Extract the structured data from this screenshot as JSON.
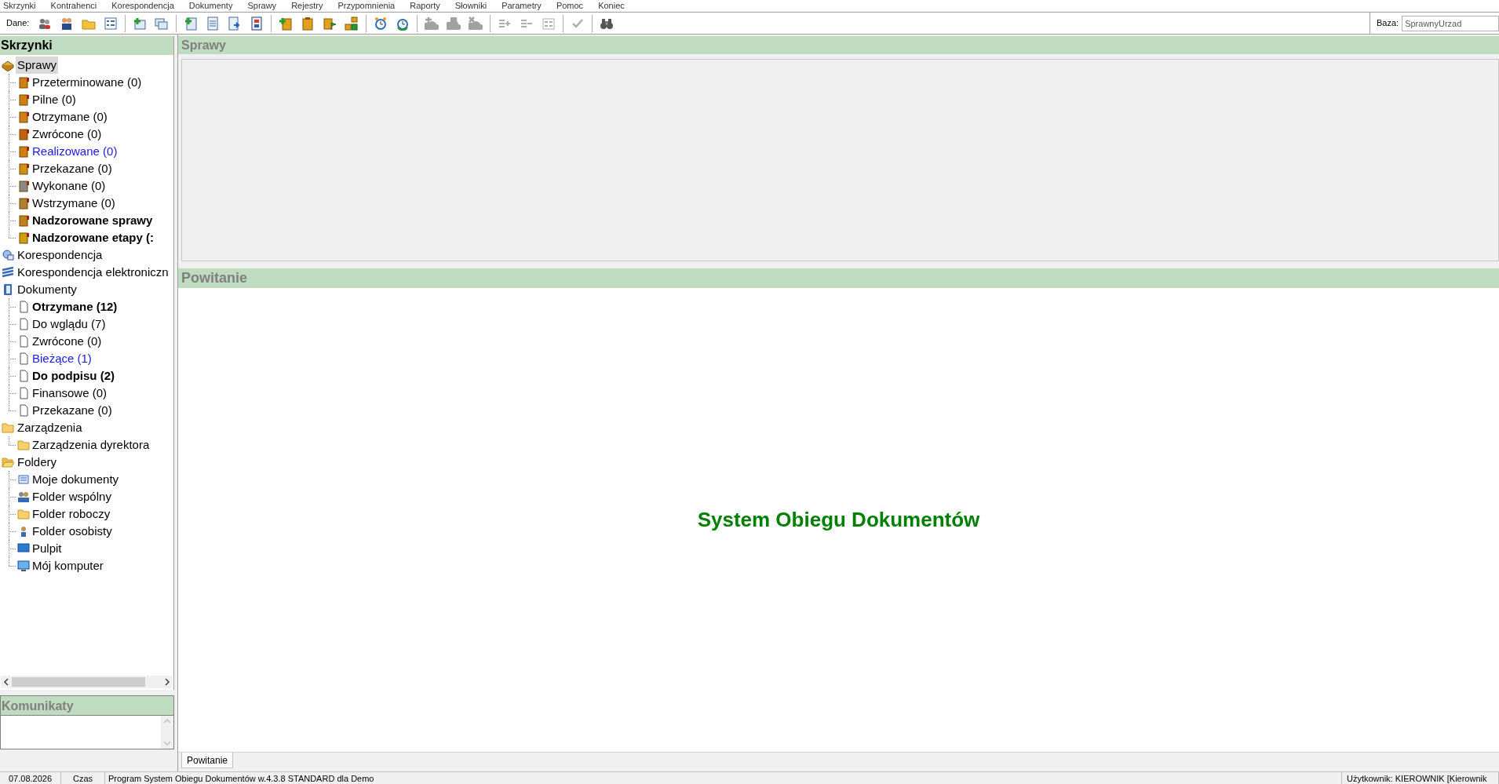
{
  "menu": [
    "Skrzynki",
    "Kontrahenci",
    "Korespondencja",
    "Dokumenty",
    "Sprawy",
    "Rejestry",
    "Przypomnienia",
    "Raporty",
    "Słowniki",
    "Parametry",
    "Pomoc",
    "Koniec"
  ],
  "toolbar": {
    "label": "Dane:",
    "groups": [
      [
        {
          "disabled": false
        },
        {
          "disabled": false
        },
        {
          "disabled": false
        },
        {
          "disabled": false
        }
      ],
      [
        {
          "disabled": false
        },
        {
          "disabled": false
        }
      ],
      [
        {
          "disabled": false
        },
        {
          "disabled": false
        },
        {
          "disabled": false
        },
        {
          "disabled": false
        }
      ],
      [
        {
          "disabled": false
        },
        {
          "disabled": false
        },
        {
          "disabled": false
        },
        {
          "disabled": false
        }
      ],
      [
        {
          "disabled": false
        },
        {
          "disabled": false
        }
      ],
      [
        {
          "disabled": true
        },
        {
          "disabled": true
        },
        {
          "disabled": true
        }
      ],
      [
        {
          "disabled": true
        },
        {
          "disabled": true
        },
        {
          "disabled": true
        }
      ],
      [
        {
          "disabled": true
        }
      ],
      [
        {
          "disabled": false
        }
      ]
    ],
    "database": {
      "label": "Baza:",
      "value": "SprawnyUrzad"
    }
  },
  "sidebar": {
    "title": "Skrzynki",
    "tree": [
      {
        "label": "Sprawy",
        "selected": true,
        "kind": "normal",
        "children": [
          {
            "label": "Przeterminowane (0)",
            "selected": false,
            "kind": "normal"
          },
          {
            "label": "Pilne (0)",
            "selected": false,
            "kind": "normal"
          },
          {
            "label": "Otrzymane (0)",
            "selected": false,
            "kind": "normal"
          },
          {
            "label": "Zwrócone (0)",
            "selected": false,
            "kind": "normal"
          },
          {
            "label": "Realizowane (0)",
            "selected": false,
            "kind": "link"
          },
          {
            "label": "Przekazane (0)",
            "selected": false,
            "kind": "normal"
          },
          {
            "label": "Wykonane (0)",
            "selected": false,
            "kind": "normal"
          },
          {
            "label": "Wstrzymane (0)",
            "selected": false,
            "kind": "normal"
          },
          {
            "label": "Nadzorowane sprawy",
            "selected": false,
            "kind": "bold"
          },
          {
            "label": "Nadzorowane etapy (:",
            "selected": false,
            "kind": "bold"
          }
        ]
      },
      {
        "label": "Korespondencja",
        "selected": false,
        "kind": "normal"
      },
      {
        "label": "Korespondencja elektroniczn",
        "selected": false,
        "kind": "normal"
      },
      {
        "label": "Dokumenty",
        "selected": false,
        "kind": "normal",
        "children": [
          {
            "label": "Otrzymane (12)",
            "selected": false,
            "kind": "bold"
          },
          {
            "label": "Do wglądu (7)",
            "selected": false,
            "kind": "normal"
          },
          {
            "label": "Zwrócone (0)",
            "selected": false,
            "kind": "normal"
          },
          {
            "label": "Bieżące (1)",
            "selected": false,
            "kind": "link"
          },
          {
            "label": "Do podpisu (2)",
            "selected": false,
            "kind": "bold"
          },
          {
            "label": "Finansowe (0)",
            "selected": false,
            "kind": "normal"
          },
          {
            "label": "Przekazane (0)",
            "selected": false,
            "kind": "normal"
          }
        ]
      },
      {
        "label": "Zarządzenia",
        "selected": false,
        "kind": "normal",
        "children": [
          {
            "label": "Zarządzenia dyrektora",
            "selected": false,
            "kind": "normal"
          }
        ]
      },
      {
        "label": "Foldery",
        "selected": false,
        "kind": "normal",
        "children": [
          {
            "label": "Moje dokumenty",
            "selected": false,
            "kind": "normal"
          },
          {
            "label": "Folder wspólny",
            "selected": false,
            "kind": "normal"
          },
          {
            "label": "Folder roboczy",
            "selected": false,
            "kind": "normal"
          },
          {
            "label": "Folder osobisty",
            "selected": false,
            "kind": "normal"
          },
          {
            "label": "Pulpit",
            "selected": false,
            "kind": "normal"
          },
          {
            "label": "Mój komputer",
            "selected": false,
            "kind": "normal"
          }
        ]
      }
    ]
  },
  "messages": {
    "title": "Komunikaty"
  },
  "cases_panel": {
    "title": "Sprawy"
  },
  "welcome_panel": {
    "title": "Powitanie",
    "heading": "System Obiegu Dokumentów"
  },
  "tabs": [
    {
      "label": "Powitanie",
      "selected": true
    }
  ],
  "status_bar": [
    "07.08.2026",
    "Czas",
    "Program System Obiegu Dokumentów w.4.3.8 STANDARD dla Demo",
    "Użytkownik: KIEROWNIK [Kierownik"
  ]
}
